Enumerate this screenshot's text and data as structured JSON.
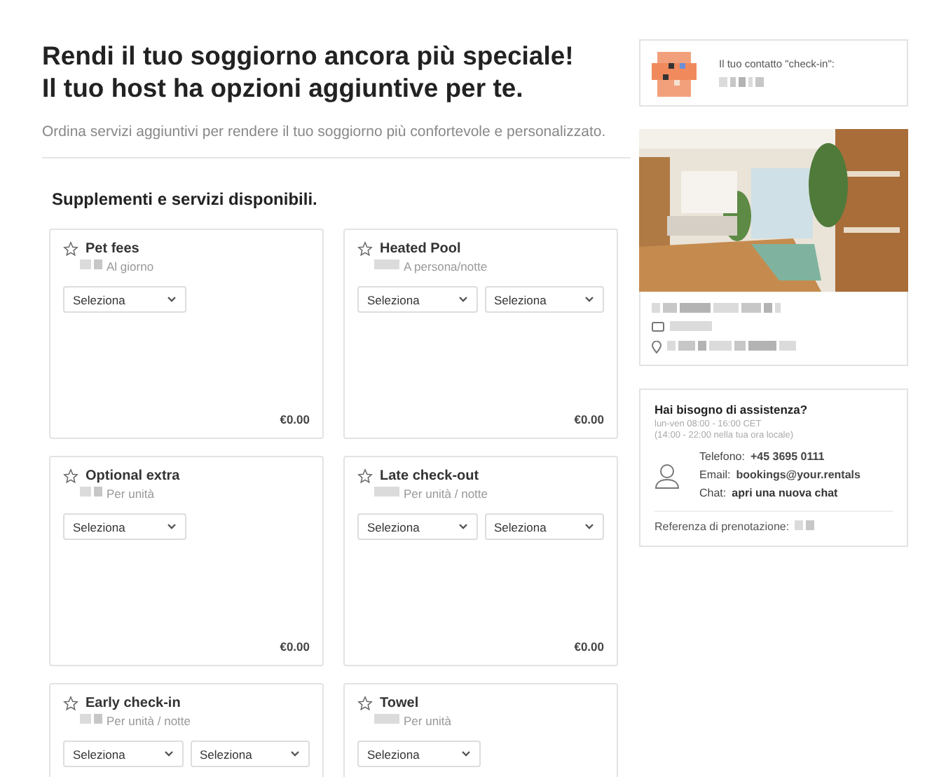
{
  "header": {
    "title_lines": [
      "Rendi il tuo soggiorno ancora più speciale!",
      "Il tuo host ha opzioni aggiuntive per te."
    ],
    "subtitle": "Ordina servizi aggiuntivi per rendere il tuo soggiorno più confortevole e personalizzato."
  },
  "section_title": "Supplementi e servizi disponibili.",
  "services": [
    {
      "name": "Pet fees",
      "unit": "Al giorno",
      "selects": [
        "Seleziona"
      ],
      "price": "€0.00"
    },
    {
      "name": "Heated Pool",
      "unit": "A persona/notte",
      "selects": [
        "Seleziona",
        "Seleziona"
      ],
      "price": "€0.00"
    },
    {
      "name": "Optional extra",
      "unit": "Per unità",
      "selects": [
        "Seleziona"
      ],
      "price": "€0.00"
    },
    {
      "name": "Late check-out",
      "unit": "Per unità / notte",
      "selects": [
        "Seleziona",
        "Seleziona"
      ],
      "price": "€0.00"
    },
    {
      "name": "Early check-in",
      "unit": "Per unità / notte",
      "selects": [
        "Seleziona",
        "Seleziona"
      ]
    },
    {
      "name": "Towel",
      "unit": "Per unità",
      "selects": [
        "Seleziona"
      ]
    }
  ],
  "contact": {
    "label": "Il tuo contatto \"check-in\":"
  },
  "help": {
    "title": "Hai bisogno di assistenza?",
    "hours": [
      "lun-ven 08:00 - 16:00 CET",
      "(14:00 - 22:00 nella tua ora locale)"
    ],
    "lines": [
      {
        "label": "Telefono:",
        "value": "+45 3695 0111"
      },
      {
        "label": "Email:",
        "value": "bookings@your.rentals"
      },
      {
        "label": "Chat:",
        "value": "apri una nuova chat",
        "kind": "link"
      }
    ],
    "reference_label": "Referenza di prenotazione:"
  }
}
